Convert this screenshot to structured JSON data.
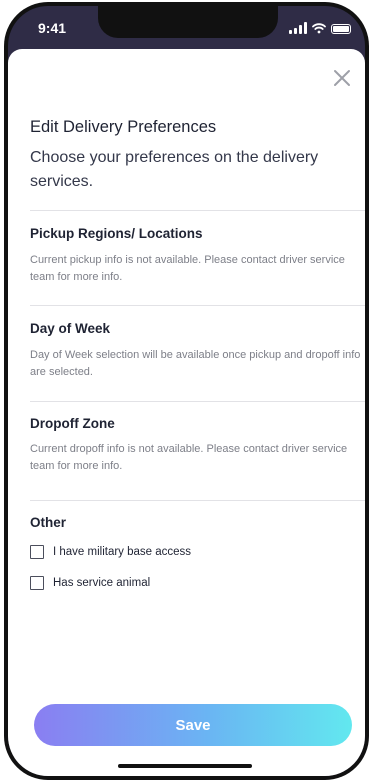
{
  "status_bar": {
    "time": "9:41"
  },
  "modal": {
    "title": "Edit Delivery Preferences",
    "subtitle": "Choose your preferences on the delivery services.",
    "sections": [
      {
        "title": "Pickup Regions/ Locations",
        "body": "Current pickup info is not available. Please contact driver service team for more info."
      },
      {
        "title": "Day of Week",
        "body": "Day of Week selection will be available once pickup and dropoff info are selected."
      },
      {
        "title": "Dropoff Zone",
        "body": "Current dropoff info is not available. Please contact driver service team for more info."
      }
    ],
    "other": {
      "title": "Other",
      "options": [
        {
          "label": "I have military base access",
          "checked": false
        },
        {
          "label": "Has service animal",
          "checked": false
        }
      ]
    },
    "save_label": "Save"
  },
  "colors": {
    "accent_gradient_start": "#8a7ef2",
    "accent_gradient_end": "#62e8ef",
    "header_bg": "#2f2c46"
  }
}
